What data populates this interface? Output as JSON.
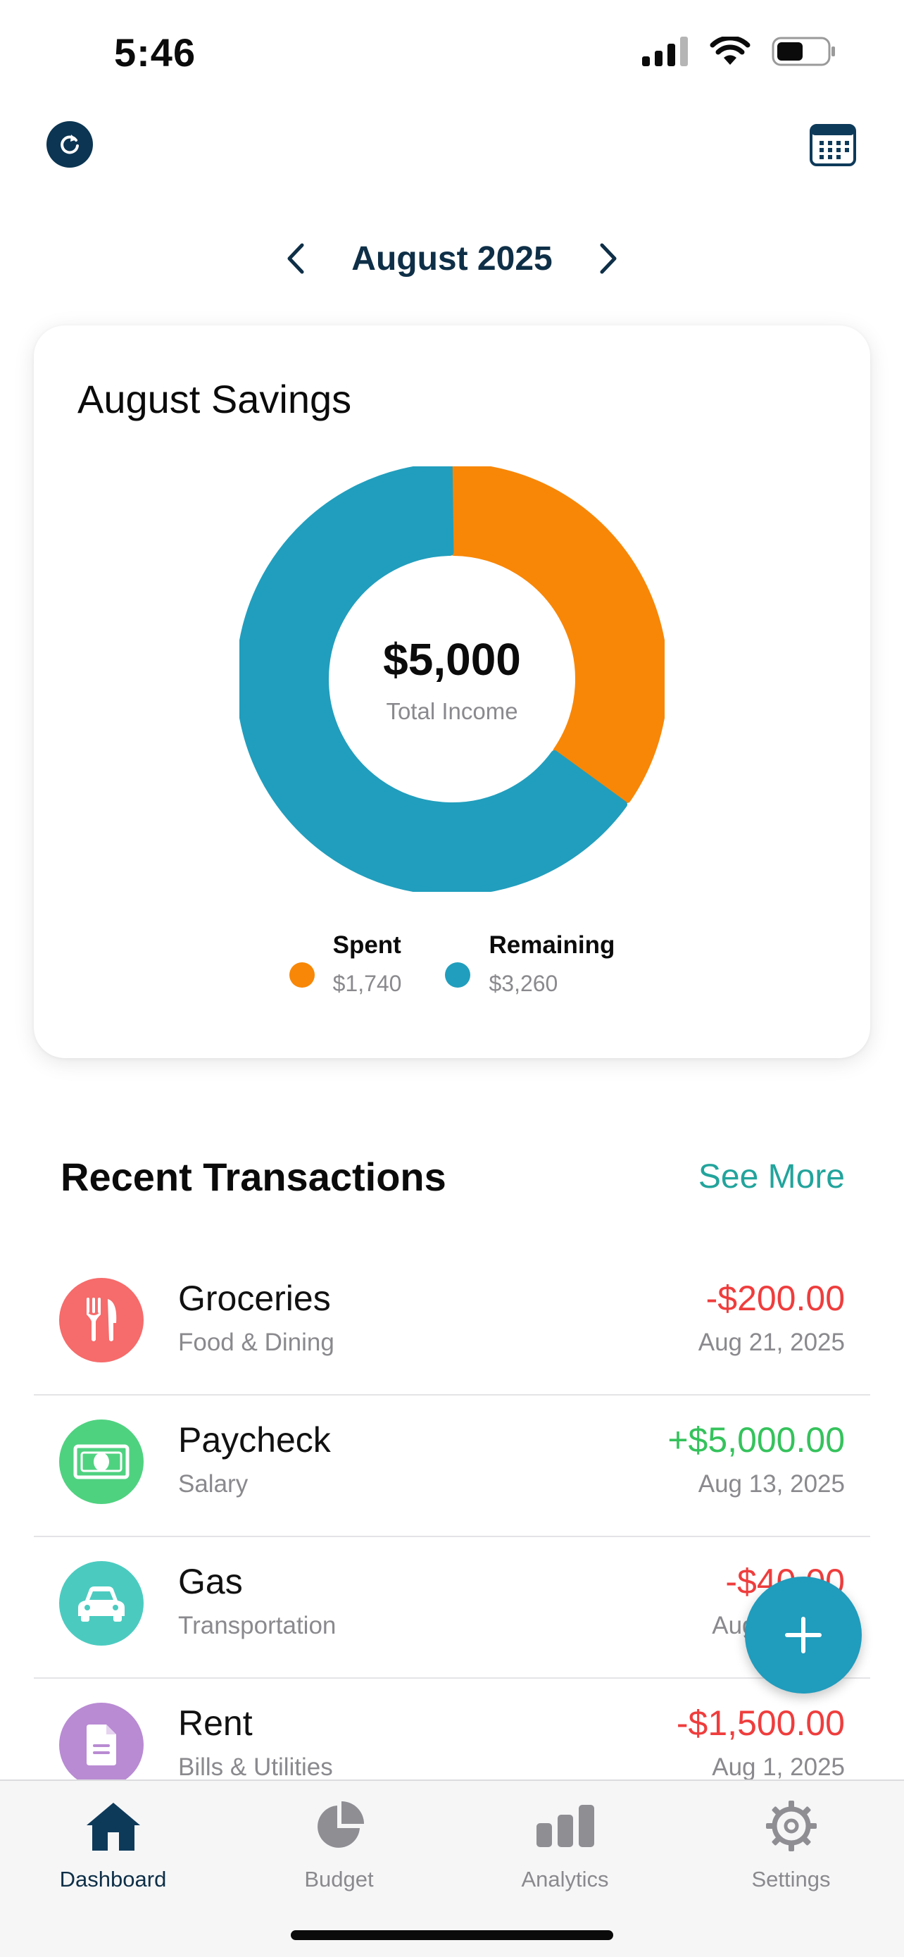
{
  "status_bar": {
    "time": "5:46"
  },
  "header": {
    "refresh_icon": "refresh-icon",
    "calendar_icon": "calendar-icon",
    "month": "August 2025"
  },
  "savings_card": {
    "title": "August Savings",
    "total_value": "$5,000",
    "total_caption": "Total Income",
    "legend": [
      {
        "name": "Spent",
        "value": "$1,740",
        "color": "#f88707"
      },
      {
        "name": "Remaining",
        "value": "$3,260",
        "color": "#219ebd"
      }
    ]
  },
  "chart_data": {
    "type": "pie",
    "categories": [
      "Spent",
      "Remaining"
    ],
    "values": [
      1740,
      3260
    ],
    "colors": [
      "#f88707",
      "#219ebd"
    ]
  },
  "recent": {
    "title": "Recent Transactions",
    "see_more": "See More",
    "transactions": [
      {
        "name": "Groceries",
        "category": "Food & Dining",
        "amount": "-$200.00",
        "date": "Aug 21, 2025",
        "icon": "fork-knife-icon",
        "color": "#f66b6b",
        "amount_color": "#ef3d3d"
      },
      {
        "name": "Paycheck",
        "category": "Salary",
        "amount": "+$5,000.00",
        "date": "Aug 13, 2025",
        "icon": "banknote-icon",
        "color": "#4fd280",
        "amount_color": "#35c25c"
      },
      {
        "name": "Gas",
        "category": "Transportation",
        "amount": "-$40.00",
        "date": "Aug 5, 2025",
        "icon": "car-icon",
        "color": "#4bcbc0",
        "amount_color": "#ef3d3d"
      },
      {
        "name": "Rent",
        "category": "Bills & Utilities",
        "amount": "-$1,500.00",
        "date": "Aug 1, 2025",
        "icon": "document-icon",
        "color": "#b98bd3",
        "amount_color": "#ef3d3d"
      }
    ]
  },
  "tabs": [
    {
      "label": "Dashboard",
      "icon": "home-icon",
      "active": true
    },
    {
      "label": "Budget",
      "icon": "pie-chart-icon",
      "active": false
    },
    {
      "label": "Analytics",
      "icon": "bar-chart-icon",
      "active": false
    },
    {
      "label": "Settings",
      "icon": "gear-icon",
      "active": false
    }
  ]
}
